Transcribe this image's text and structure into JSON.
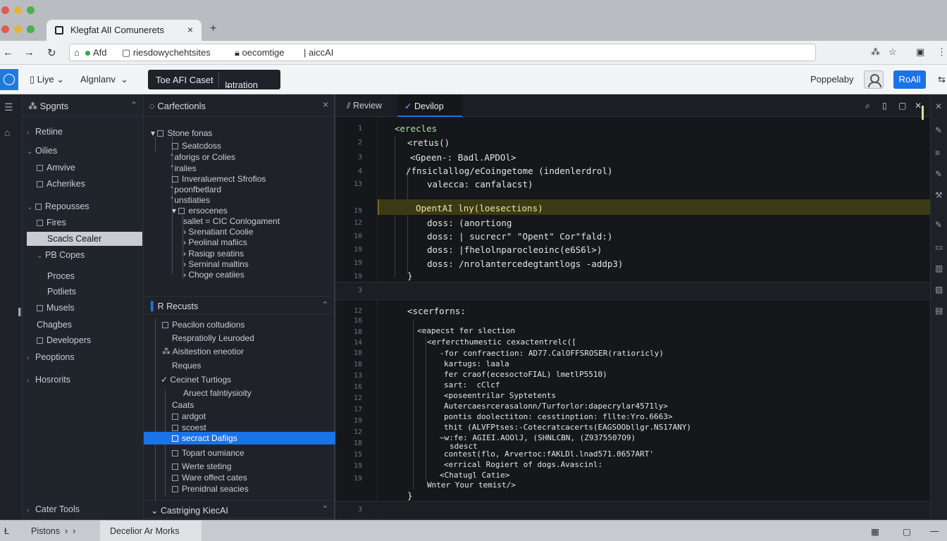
{
  "browser": {
    "tab_title": "Klegfat AlI Comunerets",
    "tab_close": "×",
    "new_tab": "+",
    "back": "←",
    "forward": "→",
    "reload": "↻",
    "address_segments": [
      "Afd",
      "riesdowychehtsites",
      "oecomtige",
      "aiccAI"
    ],
    "toolbar_icons": [
      "extensions-icon",
      "star-icon",
      "profile-icon",
      "menu-icon"
    ]
  },
  "app_header": {
    "logo_glyph": "◯",
    "menu_1": "Liye",
    "menu_2": "Algnlanv",
    "pill_left": "Toe AFI Caset",
    "pill_right": "Intration",
    "right_label": "Poppelaby",
    "primary_button": "RoAll"
  },
  "sidebar1": {
    "title": "Spgnts",
    "items": [
      {
        "label": "Retiine",
        "kind": "chev"
      },
      {
        "label": "Oilies",
        "kind": "open"
      },
      {
        "label": "Amvive",
        "kind": "file"
      },
      {
        "label": "Acherikes",
        "kind": "file"
      },
      {
        "label": "Repousses",
        "kind": "open"
      },
      {
        "label": "Fires",
        "kind": "file"
      },
      {
        "label": "Scacls Cealer",
        "kind": "selected"
      },
      {
        "label": "PB Copes",
        "kind": "open"
      },
      {
        "label": "Proces",
        "kind": "plain"
      },
      {
        "label": "Potliets",
        "kind": "plain"
      },
      {
        "label": "Musels",
        "kind": "file"
      },
      {
        "label": "Chagbes",
        "kind": "plain"
      },
      {
        "label": "Developers",
        "kind": "file"
      },
      {
        "label": "Peoptions",
        "kind": "chev"
      },
      {
        "label": "Hosrorits",
        "kind": "chev"
      },
      {
        "label": "Cater Tools",
        "kind": "chev"
      }
    ]
  },
  "sidebar2": {
    "title": "Carfectionls",
    "close": "×",
    "tree": [
      "Stone fonas",
      "Seatcdoss",
      "aforigs or Colies",
      "iralies",
      "Inveraluemect Sfrofios",
      "poonfbetlard",
      "unstiaties",
      "ersocenes",
      "sallet = CIC Conlogament",
      "Srenatiant Coolie",
      "Peolinal mafiics",
      "Rasiqp seatins",
      "Serninal maltins",
      "Choge ceatiies"
    ],
    "section2_title": "Recusts",
    "section2_items": [
      "Peacilon coltudions",
      "Respratiolly Leuroded",
      "Aisitestion eneotior",
      "Reques",
      "Cecinet Turtiogs",
      "Aruect falntiysioity",
      "Caats",
      "ardgot",
      "scoest",
      "secract Dafiigs",
      "Topart oumiance",
      "Werte steting",
      "Ware offect cates",
      "Prenidnal seacies"
    ],
    "section3_title": "Castriging KiecAI"
  },
  "editor": {
    "tab_review": "Review",
    "tab_develop": "Devilop",
    "header_icons": [
      "search-icon",
      "split-icon",
      "maximize-icon",
      "close-icon"
    ],
    "line_numbers_top": [
      "1",
      "2",
      "3",
      "4",
      "13",
      "19",
      "12",
      "10",
      "19",
      "19"
    ],
    "lines_top": [
      "<erecles",
      "<retus()",
      "<Gpeen-: Badl.APDOl>",
      "/fnsiclallog/eCoingetome (indenlerdrol)",
      "valecca: canfalacst)",
      "OpentAI lny(loesections)",
      "doss: (anortiong",
      "doss: | sucrecr\" \"Opent\" Cor\"fald:)",
      "doss: |fhelolnparocleoinc(e6S6l>)",
      "doss: /nrolantercedegtantlogs -addp3)",
      "}"
    ],
    "fold_marker": "3",
    "line_numbers_bottom": [
      "12",
      "16",
      "18",
      "14",
      "18",
      "18",
      "13",
      "16",
      "12",
      "17",
      "19",
      "12",
      "18",
      "15",
      "19",
      "19"
    ],
    "lines_bottom": [
      "<scerforns:",
      "<eapecst fer slection",
      "<erfercthumestic cexactentrelc([",
      "-for confraection: AD77.CalOFFSROSER(ratioricly)",
      "kartugs: laala",
      "fer craof(ecesoctoFIAL) lmetlP5510)",
      "sart:  cClcf",
      "<poseentrilar Syptetents",
      "Autercaesrcerasalonn/Turforlor:dapecrylar4571ly>",
      "pontis doolectiton: cesstinption: fllte:Yro.6663>",
      "thit (ALVFPtses:-Cotecratcacerts(EAGSOObllgr.NS17ANY)",
      "~w:fe: AGIEI.AOOlJ, (SHNLCBN, (Z9375507O9)",
      "sdesct",
      "contest(flo, Arvertoc:fAKLDl.lnad571.0657ART'",
      "<errical Rogiert of dogs.Avascinl:",
      "<Chatugl Catie>",
      "Wnter Your temist/>",
      "}"
    ],
    "fold_marker_2": "3"
  },
  "bottombar": {
    "toggle": "Ł",
    "breadcrumb_1": "Pistons",
    "breadcrumb_active": "Decelior Ar Morks",
    "right_icons": [
      "layout-icon",
      "square-icon",
      "minus-icon"
    ]
  },
  "colors": {
    "accent": "#1a73e8",
    "editor_bg": "#15171b",
    "highlight": "#3b3a14",
    "code_green": "#a8e6a1"
  }
}
